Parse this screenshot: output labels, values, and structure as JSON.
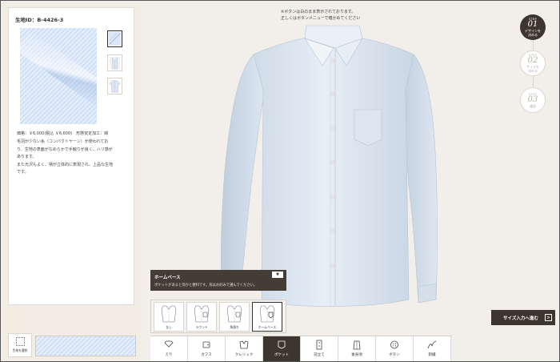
{
  "left_panel": {
    "fabric_id": "生地ID：B-4426-3",
    "price_line": "価格：￥6,000(税込 ￥6,600)　形態安定加工：綿",
    "description": [
      "毛羽が少ない糸（コンパクトヤーン）が使われてお",
      "り、生地の表面がなめらかで手触りが良く、ハリ感が",
      "あります。",
      "また光沢もよく、柄が立体的に表現され、上品な生地",
      "です。"
    ],
    "thumbnails": [
      "fabric-swatch",
      "shirt-front",
      "shirt-full"
    ],
    "swatch_select_label": "生地を選択"
  },
  "notice": {
    "line1": "※ボタンは白のまま表示されております。",
    "line2": "正しくはボタンメニューで確かめてください"
  },
  "steps": [
    {
      "label": "STEP",
      "number": "01",
      "text1": "デザインを",
      "text2": "決める"
    },
    {
      "label": "STEP",
      "number": "02",
      "text1": "サイズを",
      "text2": "決める"
    },
    {
      "label": "STEP",
      "number": "03",
      "text1": "確認",
      "text2": ""
    }
  ],
  "size_button": {
    "label": "サイズ入力へ進む",
    "arrow": ">"
  },
  "popup": {
    "title": "ホームベース",
    "description": "ポケットがあると何かと便利です。形はお好みで選んでください。",
    "collapse": "▼"
  },
  "pocket_options": [
    {
      "label": "なし",
      "selected": false
    },
    {
      "label": "ラウンド",
      "selected": false
    },
    {
      "label": "角落ち",
      "selected": false
    },
    {
      "label": "ホームベース",
      "selected": true
    }
  ],
  "tabs": [
    {
      "label": "えり",
      "icon": "collar-icon",
      "active": false
    },
    {
      "label": "カフス",
      "icon": "cuff-icon",
      "active": false
    },
    {
      "label": "クレリック",
      "icon": "cleric-icon",
      "active": false
    },
    {
      "label": "ポケット",
      "icon": "pocket-icon",
      "active": true
    },
    {
      "label": "前立て",
      "icon": "placket-icon",
      "active": false
    },
    {
      "label": "後身頃",
      "icon": "back-icon",
      "active": false
    },
    {
      "label": "ボタン",
      "icon": "button-icon",
      "active": false
    },
    {
      "label": "刺繍",
      "icon": "embroidery-icon",
      "active": false
    }
  ],
  "colors": {
    "dark": "#3c362f",
    "shirt": "#dfe9f3",
    "background": "#f2efea"
  }
}
